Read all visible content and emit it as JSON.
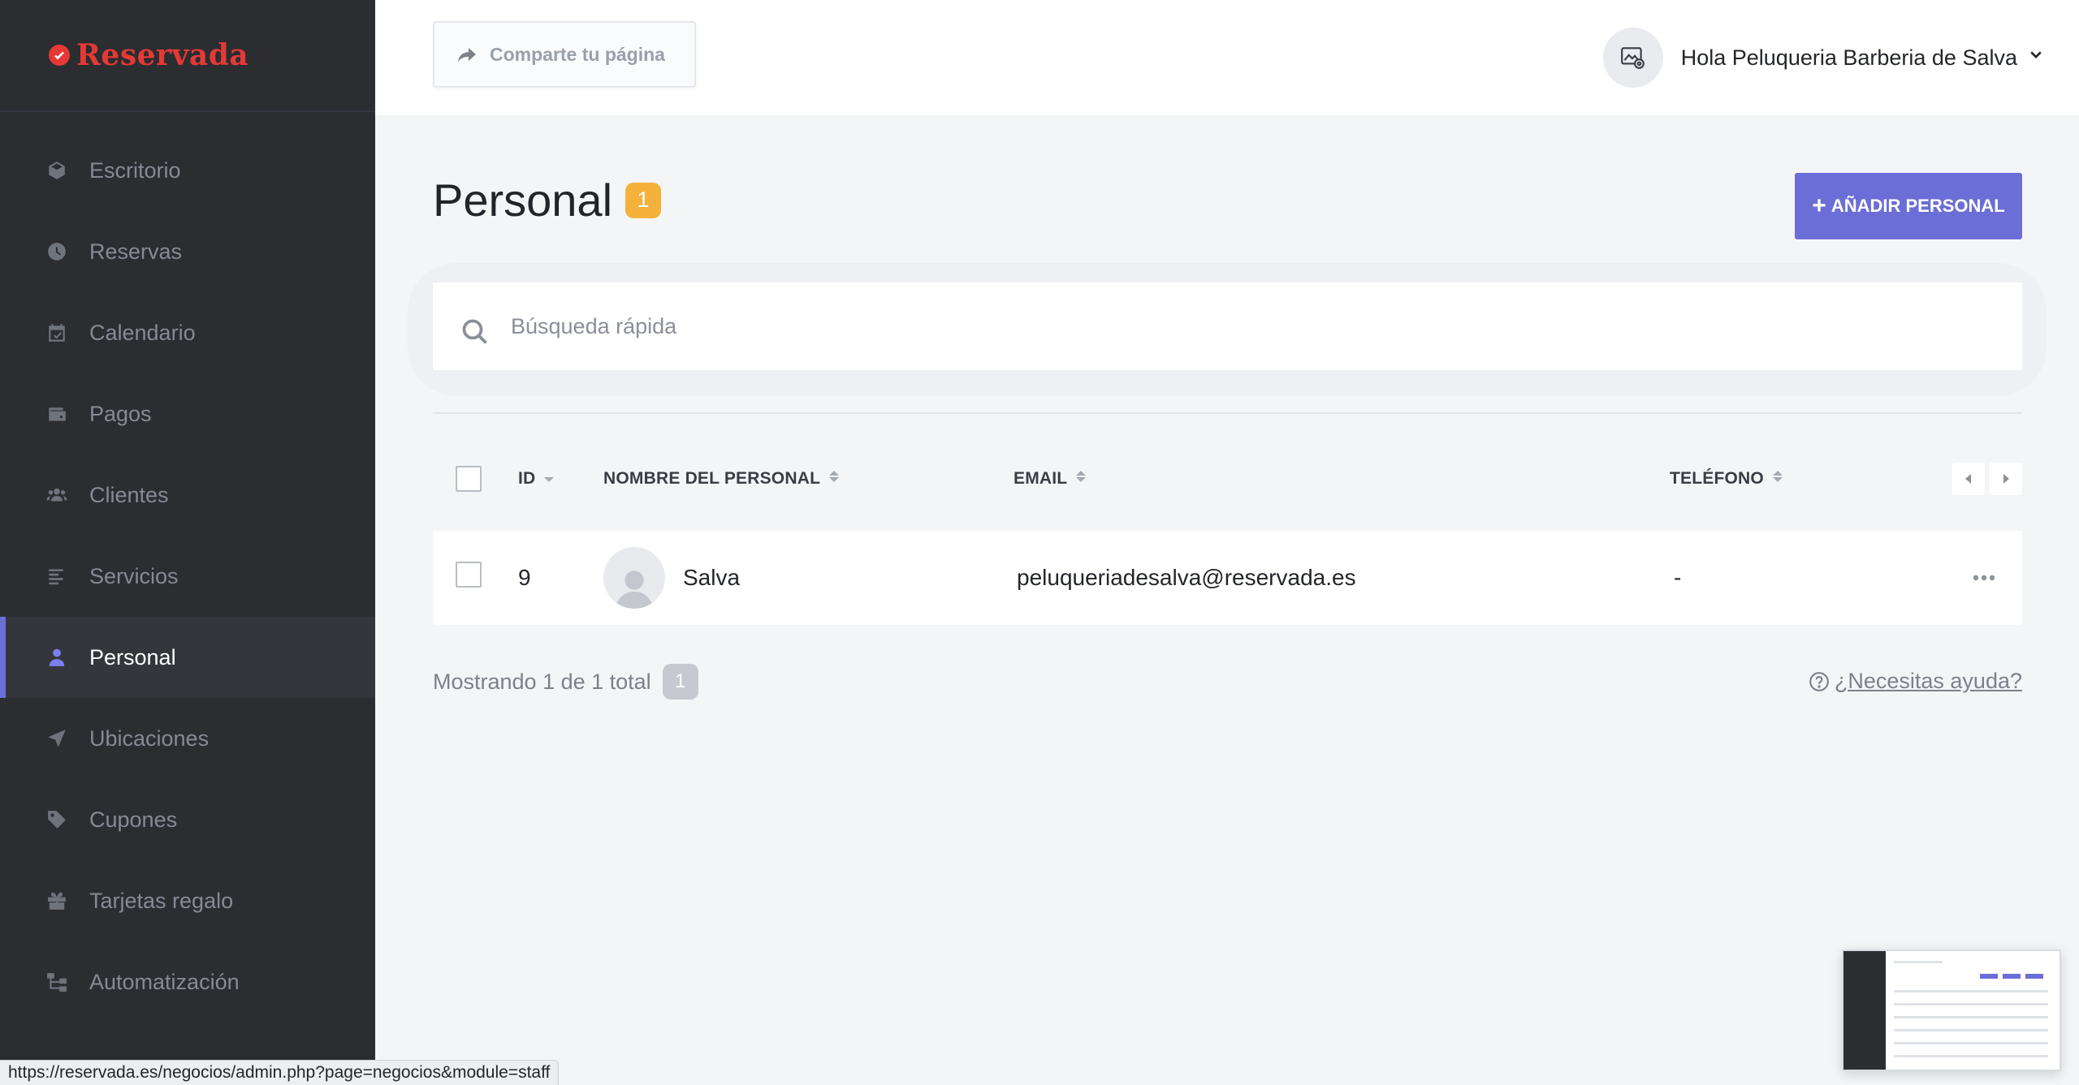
{
  "brand": {
    "name": "Reservada",
    "accent": "#e53935"
  },
  "sidebar": {
    "items": [
      {
        "label": "Escritorio",
        "icon": "dashboard-cube-icon"
      },
      {
        "label": "Reservas",
        "icon": "clock-icon"
      },
      {
        "label": "Calendario",
        "icon": "calendar-check-icon"
      },
      {
        "label": "Pagos",
        "icon": "wallet-icon"
      },
      {
        "label": "Clientes",
        "icon": "users-icon"
      },
      {
        "label": "Servicios",
        "icon": "list-icon"
      },
      {
        "label": "Personal",
        "icon": "user-icon",
        "active": true
      },
      {
        "label": "Ubicaciones",
        "icon": "location-arrow-icon"
      },
      {
        "label": "Cupones",
        "icon": "tag-icon"
      },
      {
        "label": "Tarjetas regalo",
        "icon": "gift-icon"
      },
      {
        "label": "Automatización",
        "icon": "sitemap-icon"
      }
    ]
  },
  "header": {
    "share_label": "Comparte tu página",
    "user_greeting": "Hola Peluqueria Barberia de Salva"
  },
  "main": {
    "title": "Personal",
    "count": "1",
    "add_button": "AÑADIR PERSONAL",
    "search_placeholder": "Búsqueda rápida",
    "columns": [
      "ID",
      "NOMBRE DEL PERSONAL",
      "EMAIL",
      "TELÉFONO"
    ],
    "rows": [
      {
        "id": "9",
        "name": "Salva",
        "email": "peluqueriadesalva@reservada.es",
        "phone": "-"
      }
    ],
    "footer": {
      "showing": "Mostrando 1 de 1 total",
      "total": "1"
    },
    "help_link": "¿Necesitas ayuda?"
  },
  "statusbar": {
    "url": "https://reservada.es/negocios/admin.php?page=negocios&module=staff"
  },
  "colors": {
    "primary": "#6b6ed6",
    "badge": "#f4b23c",
    "sidebar_bg": "#2b2d31"
  }
}
